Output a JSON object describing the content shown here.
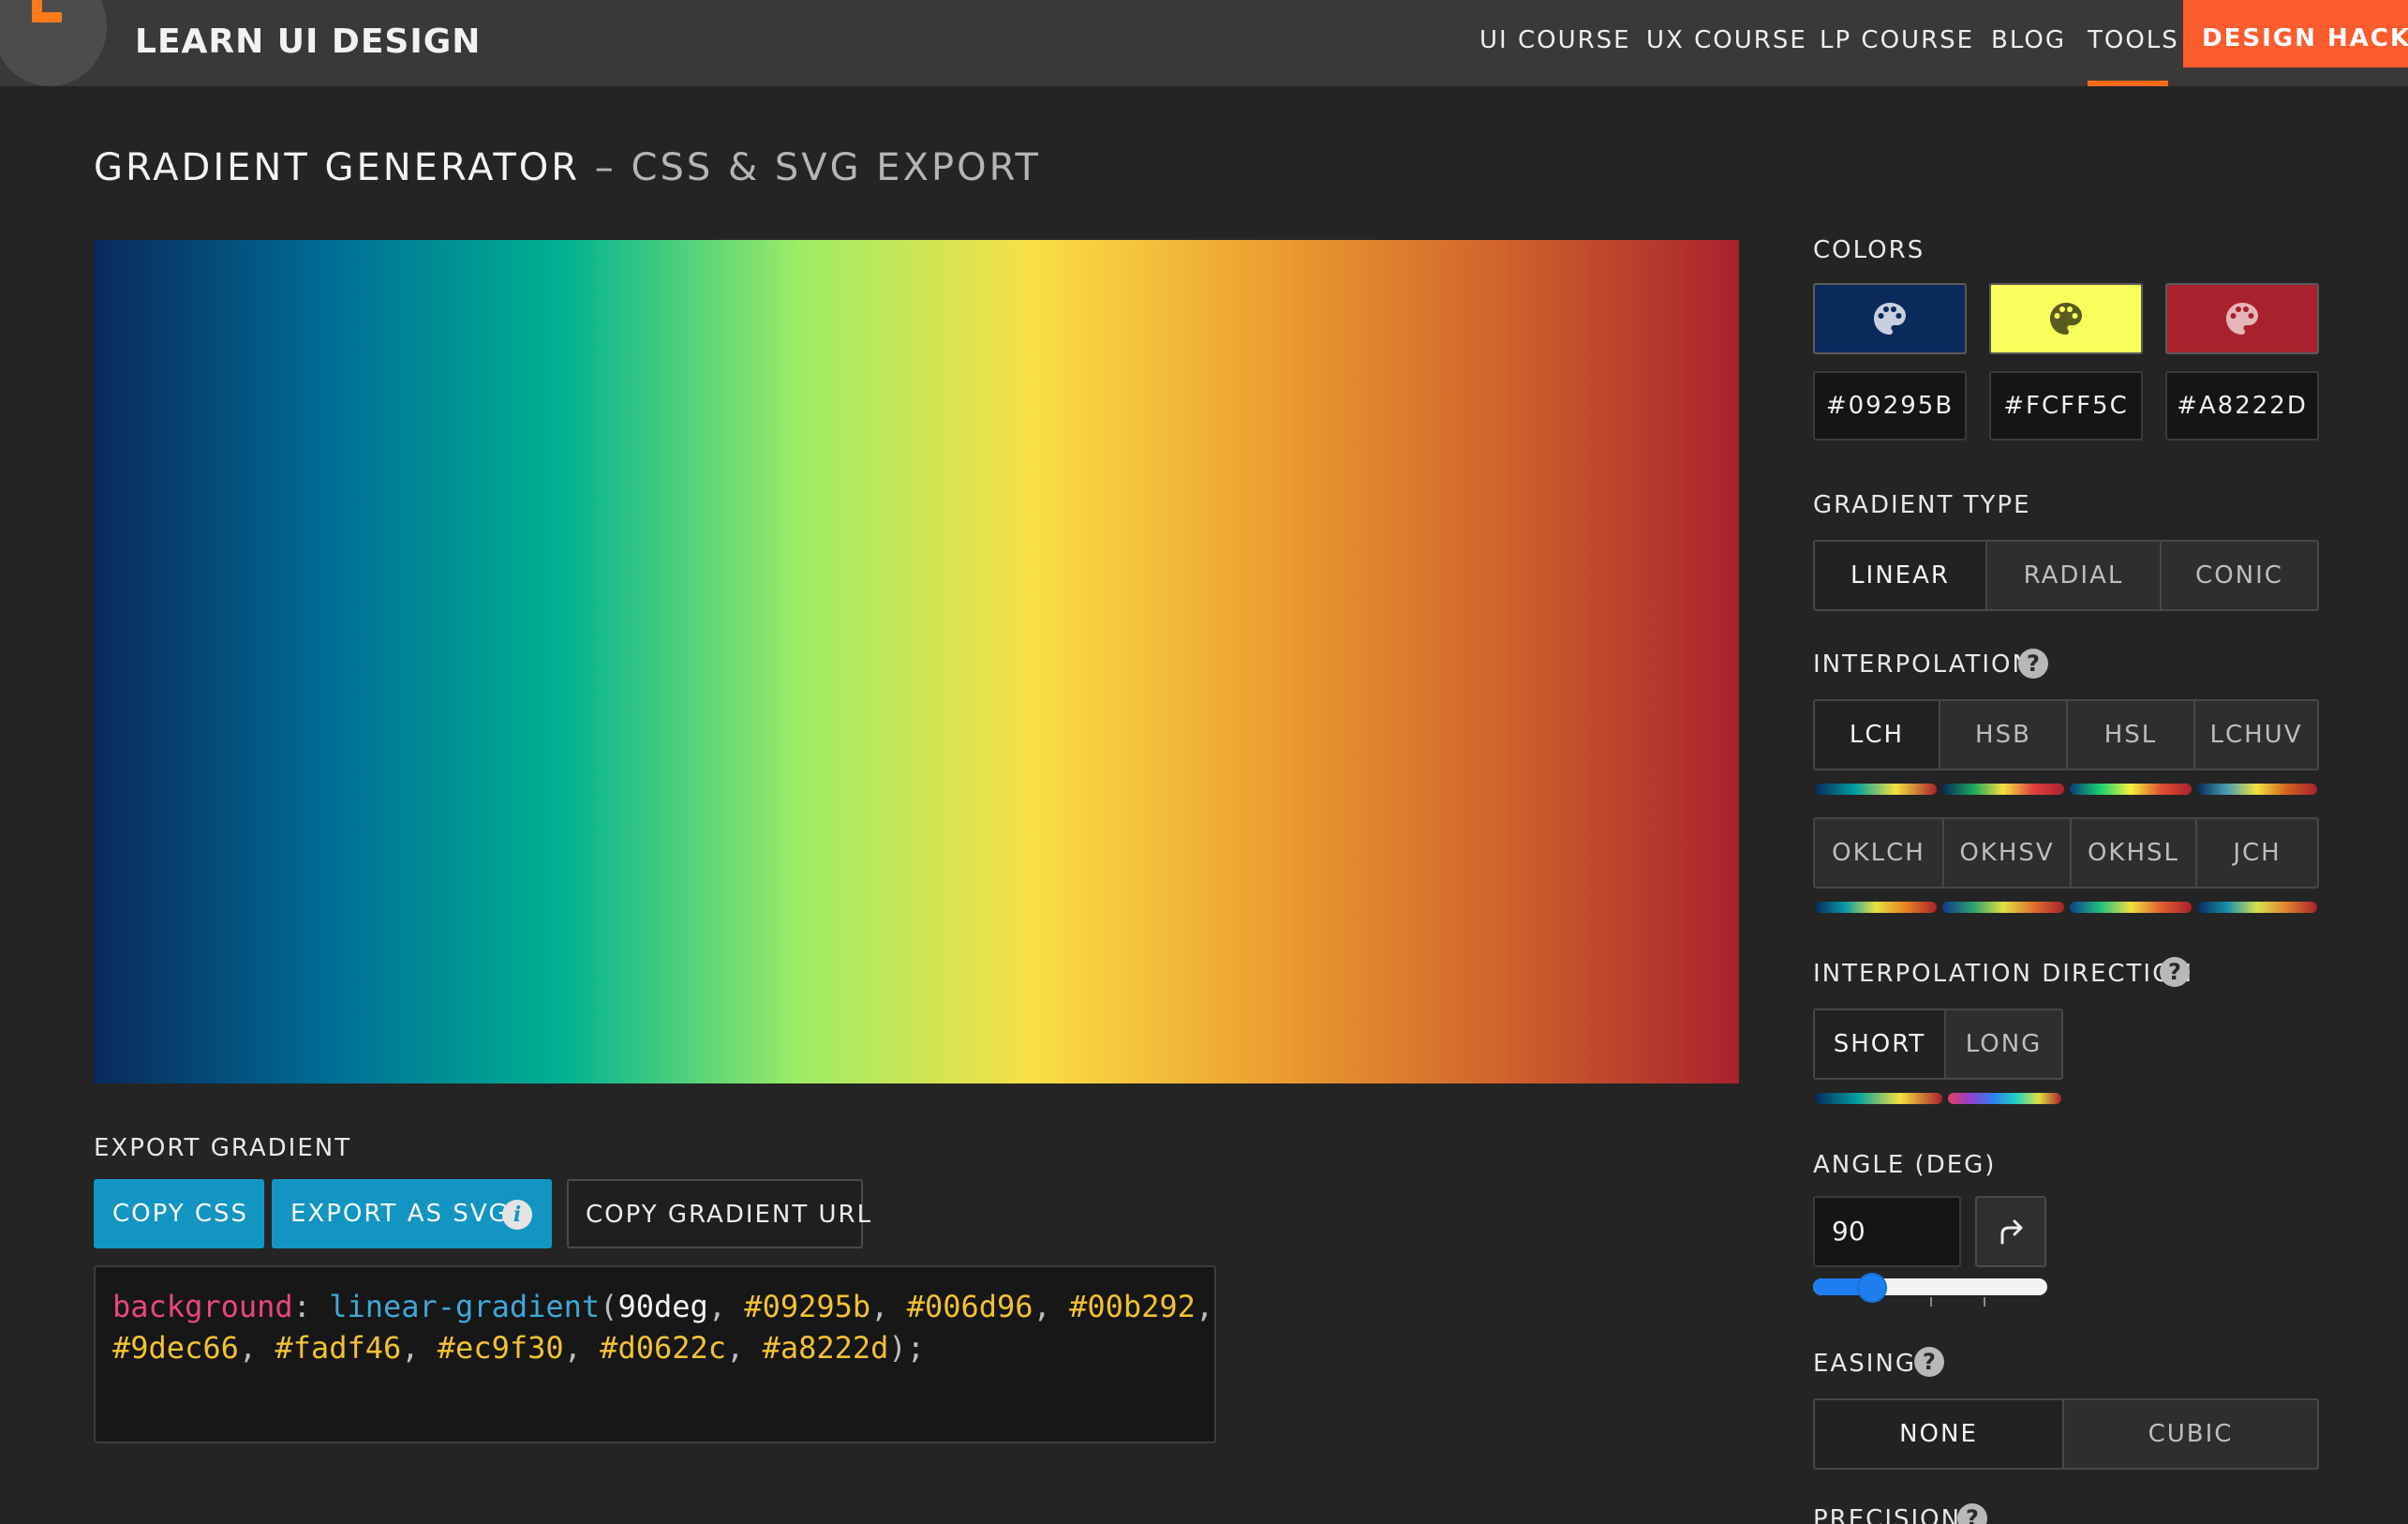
{
  "nav": {
    "brand": "LEARN UI DESIGN",
    "items": [
      "UI COURSE",
      "UX COURSE",
      "LP COURSE",
      "BLOG",
      "TOOLS"
    ],
    "cta": "DESIGN HACKS",
    "active_item": "TOOLS"
  },
  "header": {
    "title": "GRADIENT GENERATOR",
    "subtitle": "– CSS & SVG EXPORT"
  },
  "preview": {
    "angle_deg": 90,
    "stops": [
      "#09295b",
      "#006d96",
      "#00b292",
      "#9dec66",
      "#fadf46",
      "#ec9f30",
      "#d0622c",
      "#a8222d"
    ]
  },
  "export": {
    "label": "EXPORT GRADIENT",
    "copy_css": "COPY CSS",
    "export_svg": "EXPORT AS SVG",
    "info_glyph": "i",
    "copy_url": "COPY GRADIENT URL",
    "code": {
      "property": "background",
      "colon": ": ",
      "function": "linear-gradient",
      "open": "(",
      "angle": "90deg",
      "comma": ", ",
      "hex": [
        "#09295b",
        "#006d96",
        "#00b292",
        "#9dec66",
        "#fadf46",
        "#ec9f30",
        "#d0622c",
        "#a8222d"
      ],
      "close": ");"
    }
  },
  "colors": {
    "label": "COLORS",
    "swatches": [
      {
        "hex": "#09295B",
        "fill": "#0b2a5c",
        "icon": "palette-icon",
        "icon_color": "#c9cfe0"
      },
      {
        "hex": "#FCFF5C",
        "fill": "#f9ff5c",
        "icon": "palette-icon",
        "icon_color": "#5a5b1e"
      },
      {
        "hex": "#A8222D",
        "fill": "#a8222d",
        "icon": "palette-icon",
        "icon_color": "#e6b5b8"
      }
    ]
  },
  "gradient_type": {
    "label": "GRADIENT TYPE",
    "options": [
      "LINEAR",
      "RADIAL",
      "CONIC"
    ],
    "selected": "LINEAR"
  },
  "interpolation": {
    "label": "INTERPOLATION",
    "help_glyph": "?",
    "row1": [
      "LCH",
      "HSB",
      "HSL",
      "LCHUV"
    ],
    "row2": [
      "OKLCH",
      "OKHSV",
      "OKHSL",
      "JCH"
    ],
    "selected": "LCH"
  },
  "interpolation_direction": {
    "label": "INTERPOLATION DIRECTION",
    "help_glyph": "?",
    "options": [
      "SHORT",
      "LONG"
    ],
    "selected": "SHORT"
  },
  "angle": {
    "label": "ANGLE (DEG)",
    "value": "90",
    "slider_fraction": 0.25,
    "rotate_icon": "rotate-right-icon"
  },
  "easing": {
    "label": "EASING",
    "help_glyph": "?",
    "options": [
      "NONE",
      "CUBIC"
    ],
    "selected": "NONE"
  },
  "precision": {
    "label": "PRECISION",
    "help_glyph": "?"
  }
}
